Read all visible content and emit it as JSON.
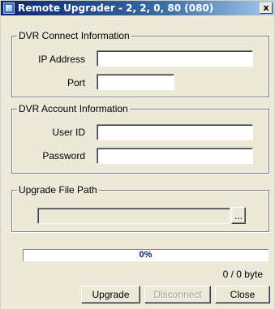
{
  "window": {
    "title": "Remote Upgrader - 2, 2, 0, 80 (080)",
    "close_label": "x"
  },
  "connect_group": {
    "title": "DVR Connect Information",
    "ip_label": "IP Address",
    "ip_value": "",
    "port_label": "Port",
    "port_value": ""
  },
  "account_group": {
    "title": "DVR Account Information",
    "user_label": "User ID",
    "user_value": "",
    "password_label": "Password",
    "password_value": ""
  },
  "upgrade_group": {
    "title": "Upgrade File Path",
    "path_value": "",
    "browse_label": "..."
  },
  "progress": {
    "percent_text": "0%",
    "fraction": 0,
    "bytes_text": "0 / 0 byte"
  },
  "buttons": {
    "upgrade": "Upgrade",
    "disconnect": "Disconnect",
    "close": "Close"
  },
  "colors": {
    "titlebar_start": "#0a246a",
    "progress": "#0a246a",
    "face": "#ece9d8"
  }
}
